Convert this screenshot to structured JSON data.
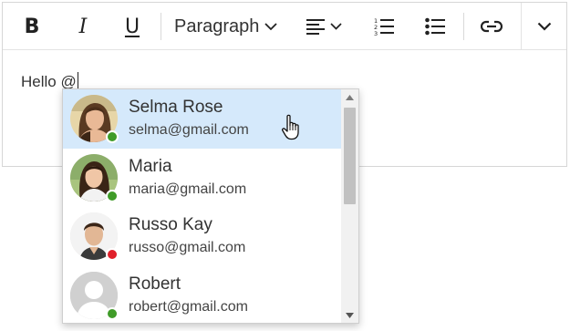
{
  "toolbar": {
    "bold_label": "B",
    "italic_label": "I",
    "underline_label": "U",
    "paragraph_label": "Paragraph"
  },
  "editor": {
    "content_text": "Hello @"
  },
  "mentions": {
    "items": [
      {
        "name": "Selma Rose",
        "email": "selma@gmail.com",
        "status": "online",
        "status_color": "#3f9b28",
        "selected": true
      },
      {
        "name": "Maria",
        "email": "maria@gmail.com",
        "status": "online",
        "status_color": "#3f9b28",
        "selected": false
      },
      {
        "name": "Russo Kay",
        "email": "russo@gmail.com",
        "status": "busy",
        "status_color": "#e0202b",
        "selected": false
      },
      {
        "name": "Robert",
        "email": "robert@gmail.com",
        "status": "online",
        "status_color": "#3f9b28",
        "selected": false
      }
    ]
  },
  "colors": {
    "selected_row": "#d5e9fb",
    "online": "#3f9b28",
    "busy": "#e0202b"
  },
  "icons": {
    "align": "align-left-icon",
    "ordered_list": "ordered-list-icon",
    "unordered_list": "unordered-list-icon",
    "link": "link-icon",
    "more": "chevron-down-icon",
    "cursor": "hand-pointer-icon"
  }
}
